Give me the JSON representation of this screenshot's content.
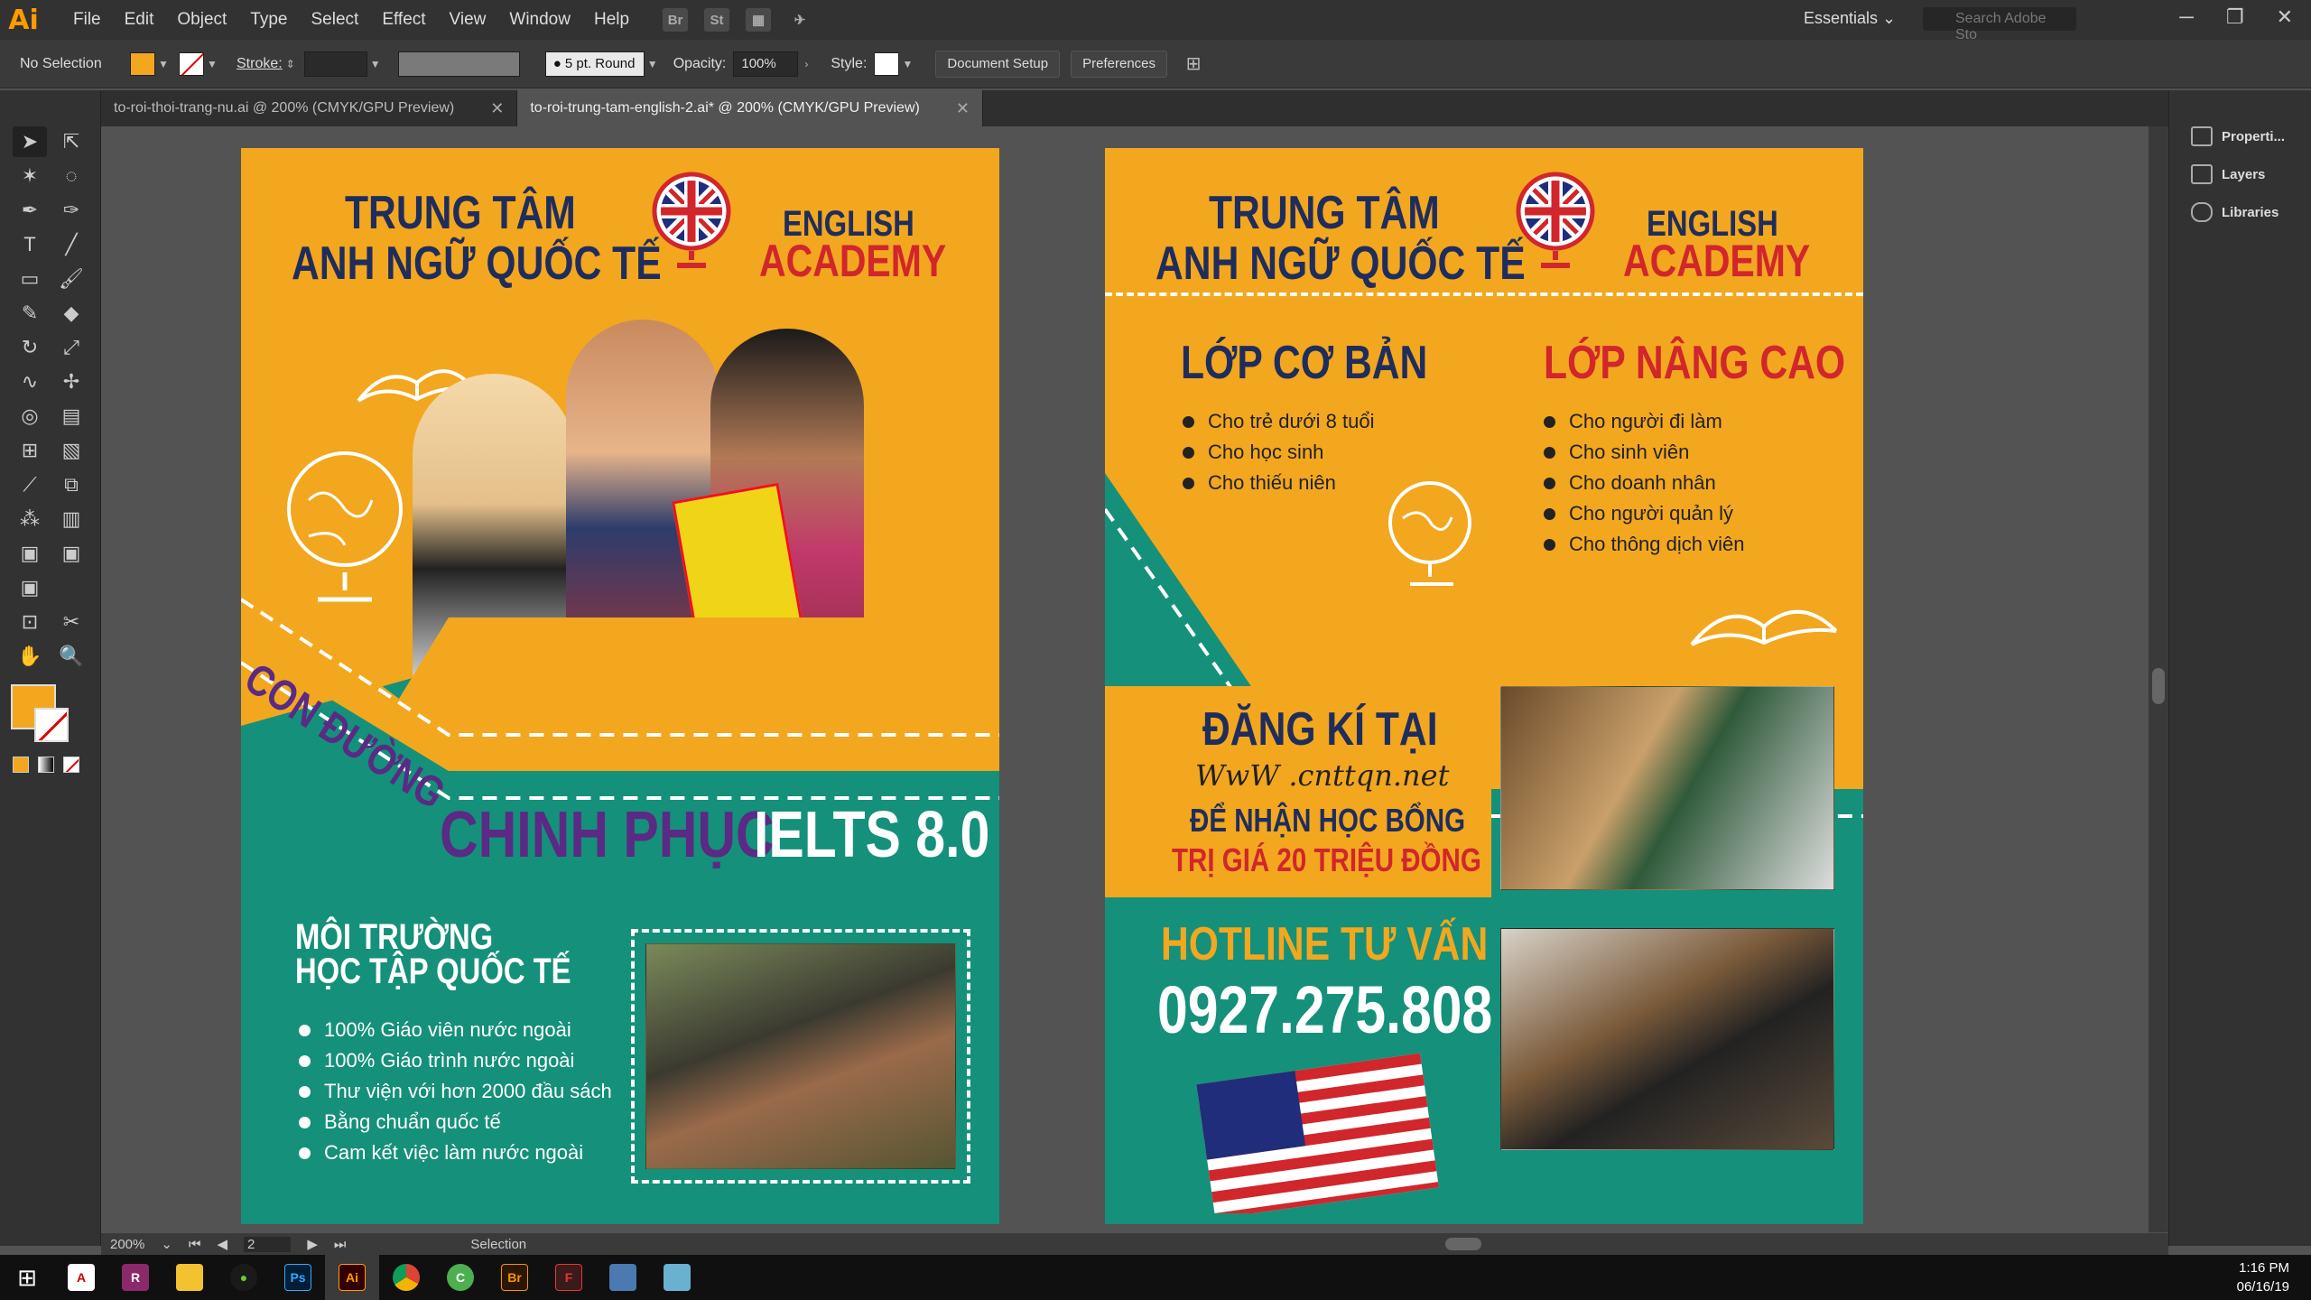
{
  "app": {
    "logo": "Ai",
    "menu": [
      "File",
      "Edit",
      "Object",
      "Type",
      "Select",
      "Effect",
      "View",
      "Window",
      "Help"
    ],
    "workspace": "Essentials",
    "search_placeholder": "Search Adobe Sto"
  },
  "control": {
    "selection": "No Selection",
    "stroke_label": "Stroke:",
    "brush": "5 pt. Round",
    "opacity_label": "Opacity:",
    "opacity": "100%",
    "style_label": "Style:",
    "doc_setup": "Document Setup",
    "preferences": "Preferences",
    "fill_color": "#f2a71f"
  },
  "tabs": [
    {
      "label": "to-roi-thoi-trang-nu.ai @ 200% (CMYK/GPU Preview)"
    },
    {
      "label": "to-roi-trung-tam-english-2.ai* @ 200% (CMYK/GPU Preview)"
    }
  ],
  "dock": [
    "Properti...",
    "Layers",
    "Libraries"
  ],
  "status": {
    "zoom": "200%",
    "artboard": "2",
    "tool": "Selection"
  },
  "clock": {
    "time": "1:16 PM",
    "date": "06/16/19"
  },
  "colors": {
    "orange": "#f2a71f",
    "teal": "#15907a",
    "navy": "#1f2d5c",
    "red": "#d0262c",
    "purple": "#5a2a84"
  },
  "flyer1": {
    "title1": "TRUNG TÂM",
    "title2": "ANH NGỮ QUỐC TẾ",
    "brand1": "ENGLISH",
    "brand2": "ACADEMY",
    "slogan1": "CON ĐƯỜNG",
    "slogan2": "CHINH PHỤC",
    "slogan3": "IELTS 8.0",
    "env_title1": "MÔI TRƯỜNG",
    "env_title2": "HỌC TẬP QUỐC TẾ",
    "bullets": [
      "100% Giáo viên nước ngoài",
      "100% Giáo trình nước ngoài",
      "Thư viện với hơn 2000 đầu sách",
      "Bằng chuẩn quốc tế",
      "Cam kết việc làm nước ngoài"
    ]
  },
  "flyer2": {
    "title1": "TRUNG TÂM",
    "title2": "ANH NGỮ QUỐC TẾ",
    "brand1": "ENGLISH",
    "brand2": "ACADEMY",
    "basic_title": "LỚP CƠ BẢN",
    "basic": [
      "Cho trẻ dưới 8 tuổi",
      "Cho học sinh",
      "Cho thiếu niên"
    ],
    "adv_title": "LỚP NÂNG CAO",
    "advanced": [
      "Cho người đi làm",
      "Cho sinh viên",
      "Cho doanh nhân",
      "Cho người quản lý",
      "Cho thông dịch viên"
    ],
    "register": "ĐĂNG KÍ TẠI",
    "website": "WwW .cnttqn.net",
    "scholarship1": "ĐỂ NHẬN HỌC BỔNG",
    "scholarship2": "TRỊ GIÁ 20 TRIỆU ĐỒNG",
    "hotline_label": "HOTLINE TƯ VẤN",
    "hotline": "0927.275.808"
  }
}
